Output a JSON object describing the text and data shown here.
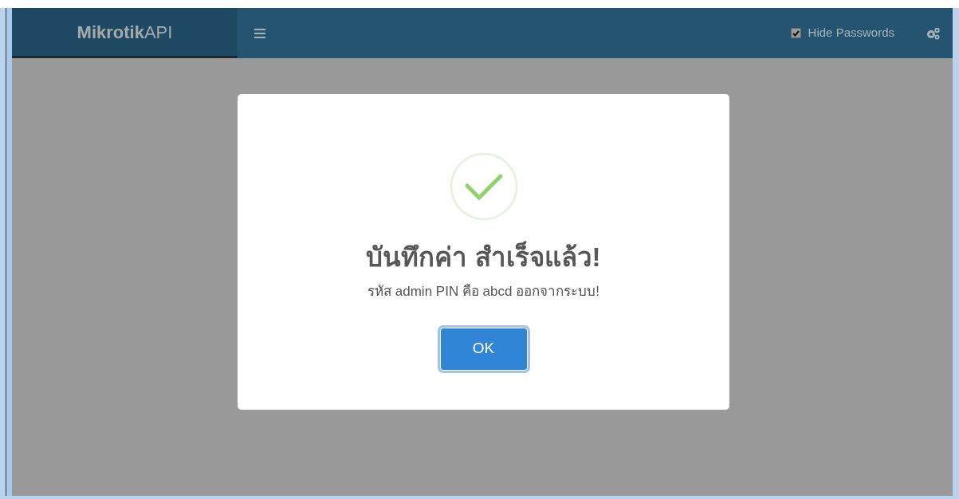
{
  "navbar": {
    "brand": "**Mikrotik**API",
    "hide_passwords": {
      "label": "Hide Passwords",
      "checked": true
    }
  },
  "dialog": {
    "kind": "success",
    "title": "บันทึกค่า สำเร็จแล้ว!",
    "message": "รหัส admin PIN คือ abcd ออกจากระบบ!",
    "button": "OK"
  }
}
